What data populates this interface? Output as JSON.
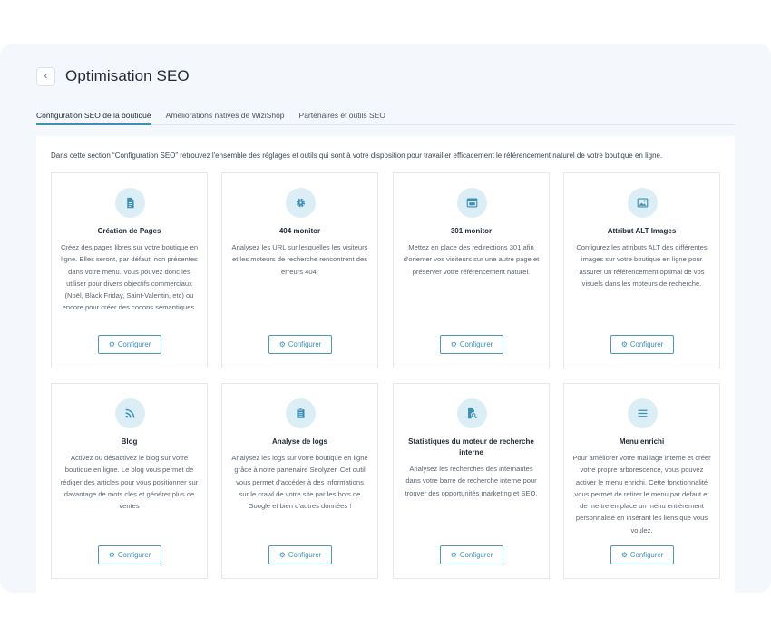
{
  "header": {
    "title": "Optimisation SEO",
    "back_icon": "‹"
  },
  "tabs": [
    {
      "label": "Configuration SEO de la boutique",
      "active": true
    },
    {
      "label": "Améliorations natives de WiziShop",
      "active": false
    },
    {
      "label": "Partenaires et outils SEO",
      "active": false
    }
  ],
  "intro": "Dans cette section “Configuration SEO” retrouvez l'ensemble des réglages et outils qui sont à votre disposition pour travailler efficacement le référencement naturel de votre boutique en ligne.",
  "colors": {
    "accent": "#3d8fb3",
    "icon_bg": "#dbeef5",
    "page_bg": "#f4f7fc"
  },
  "configure_label": "Configurer",
  "cards": [
    {
      "title": "Création de Pages",
      "icon": "document-icon",
      "desc": "Créez des pages libres sur votre boutique en ligne. Elles seront, par défaut, non présentes dans votre menu. Vous pouvez donc les utiliser pour divers objectifs commerciaux (Noël, Black Friday, Saint-Valentin, etc) ou encore pour créer des cocons sémantiques."
    },
    {
      "title": "404 monitor",
      "icon": "gear-icon",
      "desc": "Analysez les URL sur lesquelles les visiteurs et les moteurs de recherche rencontrent des erreurs 404."
    },
    {
      "title": "301 monitor",
      "icon": "browser-window-icon",
      "desc": "Mettez en place des redirections 301 afin d'orienter vos visiteurs sur une autre page et préserver votre référencement naturel."
    },
    {
      "title": "Attribut ALT Images",
      "icon": "image-icon",
      "desc": "Configurez les attributs ALT des différentes images sur votre boutique en ligne pour assurer un référencement optimal de vos visuels dans les moteurs de recherche."
    },
    {
      "title": "Blog",
      "icon": "rss-icon",
      "desc": "Activez ou désactivez le blog sur votre boutique en ligne. Le blog vous permet de rédiger des articles pour vous positionner sur davantage de mots clés et générer plus de ventes"
    },
    {
      "title": "Analyse de logs",
      "icon": "clipboard-icon",
      "desc": "Analysez les logs sur votre boutique en ligne grâce à notre partenaire Seolyzer. Cet outil vous permet d'accéder à des informations sur le crawl de votre site par les bots de Google et bien d'autres données !"
    },
    {
      "title": "Statistiques du moteur de recherche interne",
      "icon": "file-search-icon",
      "desc": "Analysez les recherches des internautes dans votre barre de recherche interne pour trouver des opportunités marketing et SEO."
    },
    {
      "title": "Menu enrichi",
      "icon": "menu-icon",
      "desc": "Pour améliorer votre maillage interne et créer votre propre arborescence, vous pouvez activer le menu enrichi. Cette fonctionnalité vous permet de retirer le menu par défaut et de mettre en place un menu entièrement personnalisé en insérant les liens que vous voulez."
    }
  ]
}
